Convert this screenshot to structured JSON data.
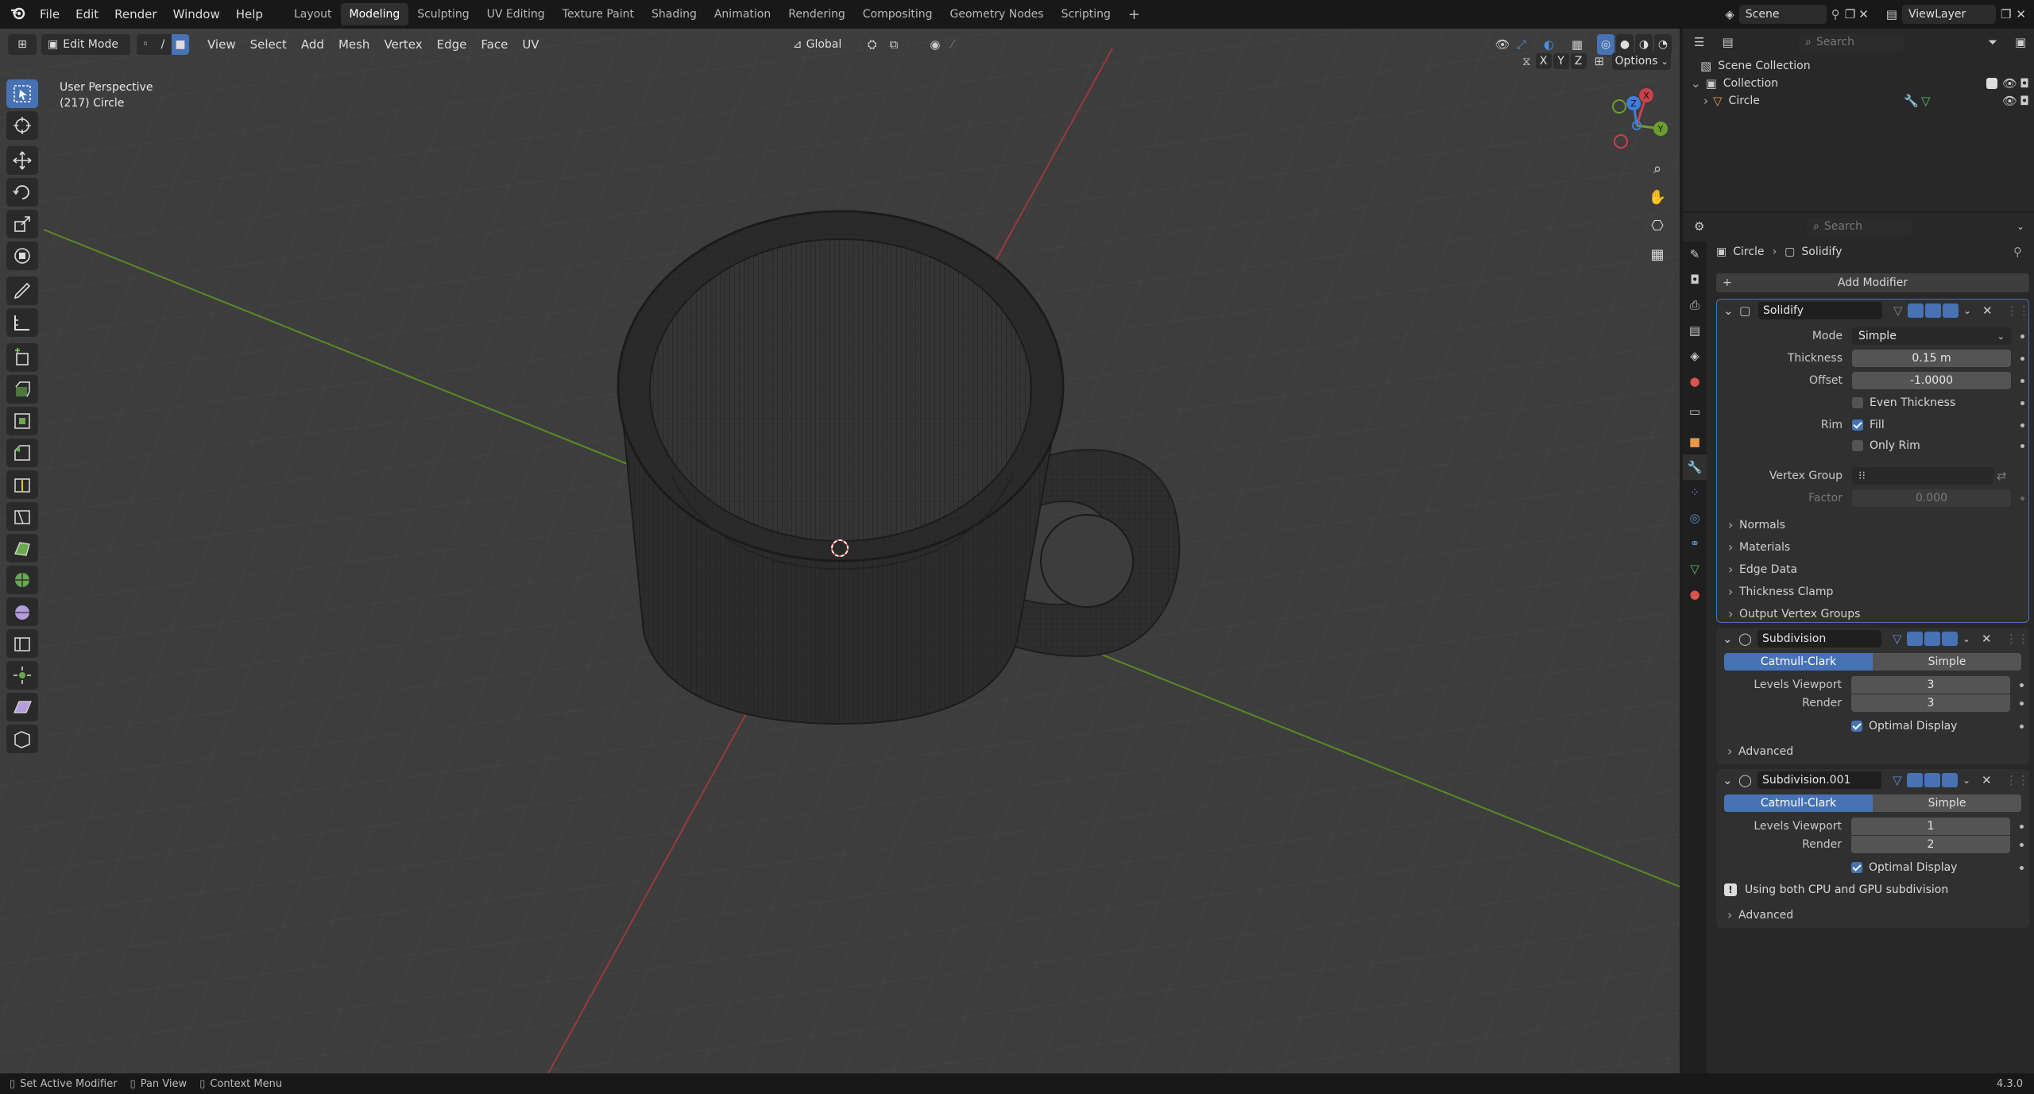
{
  "menu": {
    "items": [
      "File",
      "Edit",
      "Render",
      "Window",
      "Help"
    ]
  },
  "workspaces": {
    "tabs": [
      "Layout",
      "Modeling",
      "Sculpting",
      "UV Editing",
      "Texture Paint",
      "Shading",
      "Animation",
      "Rendering",
      "Compositing",
      "Geometry Nodes",
      "Scripting"
    ],
    "active": "Modeling",
    "add": "+"
  },
  "topright": {
    "scene": "Scene",
    "viewlayer": "ViewLayer"
  },
  "viewport_header": {
    "mode": "Edit Mode",
    "menus": [
      "View",
      "Select",
      "Add",
      "Mesh",
      "Vertex",
      "Edge",
      "Face",
      "UV"
    ],
    "transform_orientation": "Global",
    "options": "Options",
    "axes": [
      "X",
      "Y",
      "Z"
    ]
  },
  "viewport": {
    "perspective": "User Perspective",
    "object_info": "(217) Circle",
    "gizmo_axes": {
      "x": "X",
      "y": "Y",
      "z": "Z"
    }
  },
  "outliner": {
    "search_placeholder": "Search",
    "scene_collection": "Scene Collection",
    "collection": "Collection",
    "object": "Circle"
  },
  "properties": {
    "search_placeholder": "Search",
    "breadcrumb": {
      "object": "Circle",
      "modifier": "Solidify"
    },
    "add_modifier": "Add Modifier",
    "solidify": {
      "name": "Solidify",
      "mode_label": "Mode",
      "mode_value": "Simple",
      "thickness_label": "Thickness",
      "thickness_value": "0.15 m",
      "offset_label": "Offset",
      "offset_value": "-1.0000",
      "even_thickness": "Even Thickness",
      "rim_label": "Rim",
      "rim_fill": "Fill",
      "only_rim": "Only Rim",
      "vertex_group_label": "Vertex Group",
      "factor_label": "Factor",
      "factor_value": "0.000",
      "subpanels": [
        "Normals",
        "Materials",
        "Edge Data",
        "Thickness Clamp",
        "Output Vertex Groups"
      ]
    },
    "subdivision": {
      "name": "Subdivision",
      "method_a": "Catmull-Clark",
      "method_b": "Simple",
      "levels_viewport_label": "Levels Viewport",
      "levels_viewport_value": "3",
      "render_label": "Render",
      "render_value": "3",
      "optimal_display": "Optimal Display",
      "advanced": "Advanced"
    },
    "subdivision_001": {
      "name": "Subdivision.001",
      "method_a": "Catmull-Clark",
      "method_b": "Simple",
      "levels_viewport_label": "Levels Viewport",
      "levels_viewport_value": "1",
      "render_label": "Render",
      "render_value": "2",
      "optimal_display": "Optimal Display",
      "info": "Using both CPU and GPU subdivision",
      "advanced": "Advanced"
    }
  },
  "statusbar": {
    "left_hint": "Set Active Modifier",
    "middle_hint": "Pan View",
    "right_hint": "Context Menu",
    "version": "4.3.0"
  },
  "colors": {
    "accent": "#4772b3",
    "x_axis": "#c9414a",
    "y_axis": "#6d9e2a",
    "z_axis": "#3f7ddb",
    "viewport_bg": "#3d3d3d"
  }
}
